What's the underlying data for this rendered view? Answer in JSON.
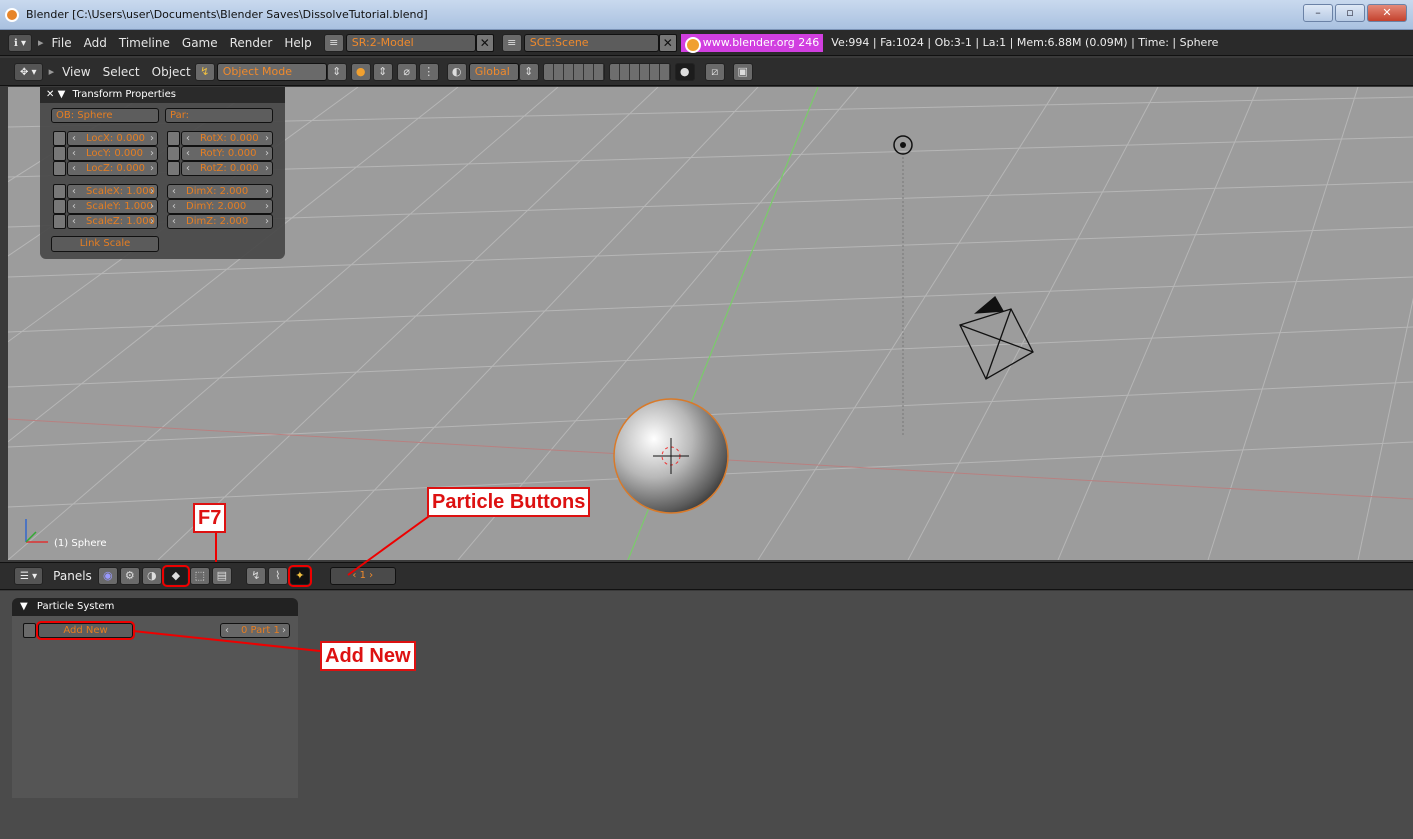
{
  "window": {
    "title": "Blender [C:\\Users\\user\\Documents\\Blender Saves\\DissolveTutorial.blend]",
    "controls": [
      "–",
      "▫",
      "✕"
    ]
  },
  "info_header": {
    "menus": [
      "File",
      "Add",
      "Timeline",
      "Game",
      "Render",
      "Help"
    ],
    "screen_field": "SR:2-Model",
    "scene_field": "SCE:Scene",
    "url": "www.blender.org 246",
    "stats": "Ve:994 | Fa:1024 | Ob:3-1 | La:1  | Mem:6.88M (0.09M)  | Time: | Sphere"
  },
  "view_header": {
    "menus": [
      "View",
      "Select",
      "Object"
    ],
    "mode_select": "Object Mode",
    "orientation_select": "Global"
  },
  "transform_panel": {
    "title": "Transform Properties",
    "ob_name": "OB: Sphere",
    "parent_field": "Par:",
    "loc": [
      "LocX: 0.000",
      "LocY: 0.000",
      "LocZ: 0.000"
    ],
    "rot": [
      "RotX: 0.000",
      "RotY: 0.000",
      "RotZ: 0.000"
    ],
    "scale": [
      "ScaleX: 1.000",
      "ScaleY: 1.000",
      "ScaleZ: 1.000"
    ],
    "dim": [
      "DimX: 2.000",
      "DimY: 2.000",
      "DimZ: 2.000"
    ],
    "link_scale": "Link Scale"
  },
  "viewport": {
    "object_label": "(1) Sphere"
  },
  "annotations": {
    "f7": "F7",
    "particle_buttons": "Particle Buttons",
    "add_new": "Add New"
  },
  "buttons_header": {
    "panels_label": "Panels",
    "frame_field": "1"
  },
  "particle_panel": {
    "title": "Particle System",
    "add_new": "Add New",
    "part_field": "0 Part 1"
  },
  "colors": {
    "accent_orange": "#f08a2c",
    "highlight_red": "#dd1111",
    "url_magenta": "#d13fe0"
  }
}
